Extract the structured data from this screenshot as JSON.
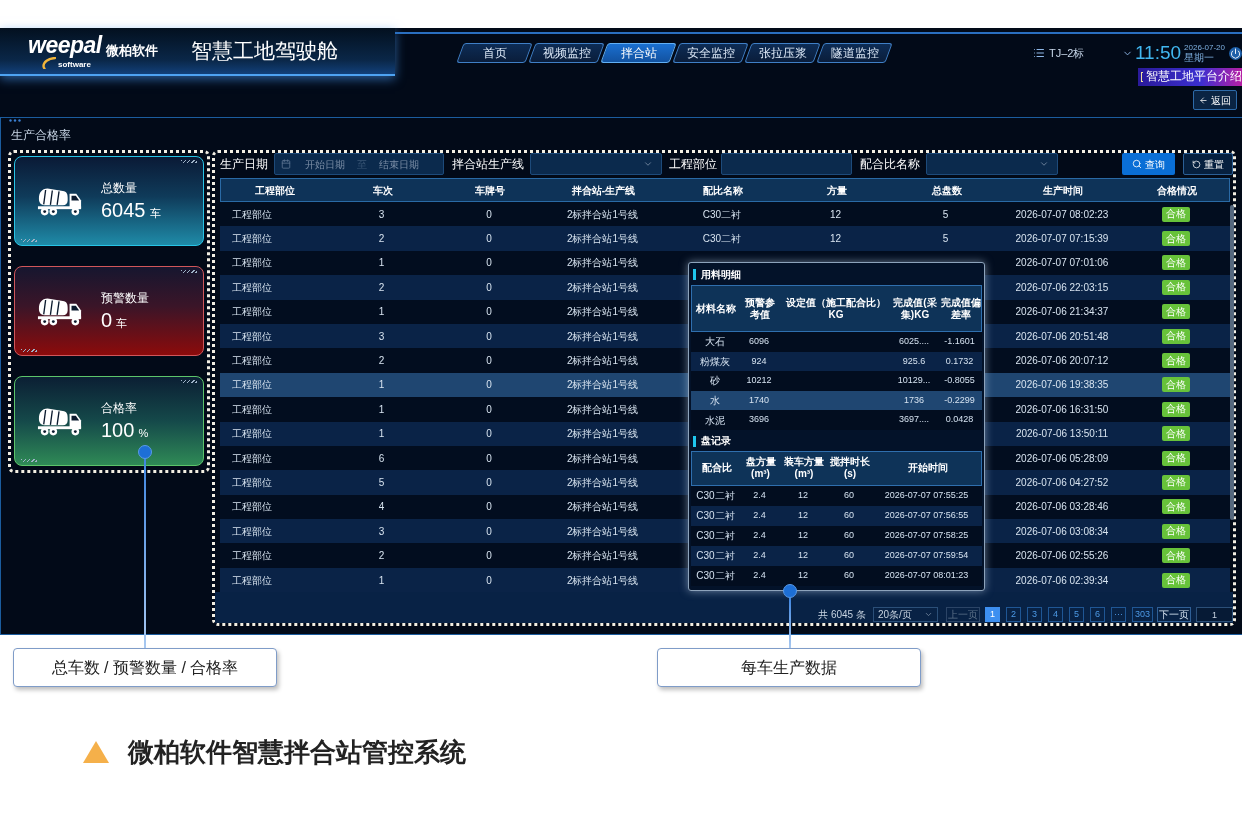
{
  "header": {
    "logo": {
      "wordmark": "weepal",
      "tagline": "software",
      "company": "微柏软件"
    },
    "title": "智慧工地驾驶舱",
    "nav_tabs": [
      {
        "label": "首页",
        "selected": false
      },
      {
        "label": "视频监控",
        "selected": false
      },
      {
        "label": "拌合站",
        "selected": true
      },
      {
        "label": "安全监控",
        "selected": false
      },
      {
        "label": "张拉压浆",
        "selected": false
      },
      {
        "label": "隧道监控",
        "selected": false
      }
    ],
    "project": "TJ–2标",
    "time": "11:50",
    "date": "2026-07-20",
    "weekday": "星期一",
    "intro_banner": "智慧工地平台介绍",
    "back_button": "返回"
  },
  "section_title": "生产合格率",
  "stat_cards": [
    {
      "kind": "total",
      "label": "总数量",
      "value": "6045",
      "unit": "车"
    },
    {
      "kind": "warning",
      "label": "预警数量",
      "value": "0",
      "unit": "车"
    },
    {
      "kind": "rate",
      "label": "合格率",
      "value": "100",
      "unit": "%"
    }
  ],
  "filters": {
    "date_label": "生产日期",
    "start_placeholder": "开始日期",
    "separator": "至",
    "end_placeholder": "结束日期",
    "line_label": "拌合站生产线",
    "part_label": "工程部位",
    "mix_label": "配合比名称",
    "query_button": "查询",
    "reset_button": "重置"
  },
  "table": {
    "columns": [
      "工程部位",
      "车次",
      "车牌号",
      "拌合站-生产线",
      "配比名称",
      "方量",
      "总盘数",
      "生产时间",
      "合格情况"
    ],
    "rows": [
      {
        "part": "工程部位",
        "trip": "3",
        "plate": "0",
        "line": "2标拌合站1号线",
        "mix": "C30二衬",
        "volume": "12",
        "batches": "5",
        "time": "2026-07-07 08:02:23",
        "status": "合格",
        "selected": false
      },
      {
        "part": "工程部位",
        "trip": "2",
        "plate": "0",
        "line": "2标拌合站1号线",
        "mix": "C30二衬",
        "volume": "12",
        "batches": "5",
        "time": "2026-07-07 07:15:39",
        "status": "合格",
        "selected": false
      },
      {
        "part": "工程部位",
        "trip": "1",
        "plate": "0",
        "line": "2标拌合站1号线",
        "time": "2026-07-07 07:01:06",
        "status": "合格",
        "selected": false
      },
      {
        "part": "工程部位",
        "trip": "2",
        "plate": "0",
        "line": "2标拌合站1号线",
        "time": "2026-07-06 22:03:15",
        "status": "合格",
        "selected": false
      },
      {
        "part": "工程部位",
        "trip": "1",
        "plate": "0",
        "line": "2标拌合站1号线",
        "time": "2026-07-06 21:34:37",
        "status": "合格",
        "selected": false
      },
      {
        "part": "工程部位",
        "trip": "3",
        "plate": "0",
        "line": "2标拌合站1号线",
        "time": "2026-07-06 20:51:48",
        "status": "合格",
        "selected": false
      },
      {
        "part": "工程部位",
        "trip": "2",
        "plate": "0",
        "line": "2标拌合站1号线",
        "time": "2026-07-06 20:07:12",
        "status": "合格",
        "selected": false
      },
      {
        "part": "工程部位",
        "trip": "1",
        "plate": "0",
        "line": "2标拌合站1号线",
        "time": "2026-07-06 19:38:35",
        "status": "合格",
        "selected": true
      },
      {
        "part": "工程部位",
        "trip": "1",
        "plate": "0",
        "line": "2标拌合站1号线",
        "time": "2026-07-06 16:31:50",
        "status": "合格",
        "selected": false
      },
      {
        "part": "工程部位",
        "trip": "1",
        "plate": "0",
        "line": "2标拌合站1号线",
        "time": "2026-07-06 13:50:11",
        "status": "合格",
        "selected": false
      },
      {
        "part": "工程部位",
        "trip": "6",
        "plate": "0",
        "line": "2标拌合站1号线",
        "time": "2026-07-06 05:28:09",
        "status": "合格",
        "selected": false
      },
      {
        "part": "工程部位",
        "trip": "5",
        "plate": "0",
        "line": "2标拌合站1号线",
        "time": "2026-07-06 04:27:52",
        "status": "合格",
        "selected": false
      },
      {
        "part": "工程部位",
        "trip": "4",
        "plate": "0",
        "line": "2标拌合站1号线",
        "time": "2026-07-06 03:28:46",
        "status": "合格",
        "selected": false
      },
      {
        "part": "工程部位",
        "trip": "3",
        "plate": "0",
        "line": "2标拌合站1号线",
        "time": "2026-07-06 03:08:34",
        "status": "合格",
        "selected": false
      },
      {
        "part": "工程部位",
        "trip": "2",
        "plate": "0",
        "line": "2标拌合站1号线",
        "time": "2026-07-06 02:55:26",
        "status": "合格",
        "selected": false
      },
      {
        "part": "工程部位",
        "trip": "1",
        "plate": "0",
        "line": "2标拌合站1号线",
        "time": "2026-07-06 02:39:34",
        "status": "合格",
        "selected": false
      }
    ]
  },
  "detail_popup": {
    "materials": {
      "title": "用料明细",
      "columns": [
        "材料名称",
        "预警参考值",
        "设定值（施工配合比）KG",
        "完成值(采集)KG",
        "完成值偏差率"
      ],
      "rows": [
        {
          "name": "大石",
          "warning_ref": "6096",
          "done": "6025....",
          "deviation": "-1.1601",
          "selected": false
        },
        {
          "name": "粉煤灰",
          "warning_ref": "924",
          "done": "925.6",
          "deviation": "0.1732",
          "selected": false
        },
        {
          "name": "砂",
          "warning_ref": "10212",
          "done": "10129...",
          "deviation": "-0.8055",
          "selected": false
        },
        {
          "name": "水",
          "warning_ref": "1740",
          "done": "1736",
          "deviation": "-0.2299",
          "selected": true
        },
        {
          "name": "水泥",
          "warning_ref": "3696",
          "done": "3697....",
          "deviation": "0.0428",
          "selected": false
        }
      ]
    },
    "batches": {
      "title": "盘记录",
      "columns": [
        "配合比",
        "盘方量(m³)",
        "装车方量(m³)",
        "搅拌时长(s)",
        "开始时间"
      ],
      "rows": [
        [
          "C30二衬",
          "2.4",
          "12",
          "60",
          "2026-07-07 07:55:25"
        ],
        [
          "C30二衬",
          "2.4",
          "12",
          "60",
          "2026-07-07 07:56:55"
        ],
        [
          "C30二衬",
          "2.4",
          "12",
          "60",
          "2026-07-07 07:58:25"
        ],
        [
          "C30二衬",
          "2.4",
          "12",
          "60",
          "2026-07-07 07:59:54"
        ],
        [
          "C30二衬",
          "2.4",
          "12",
          "60",
          "2026-07-07 08:01:23"
        ]
      ]
    }
  },
  "pagination": {
    "total": "共 6045 条",
    "page_size": "20条/页",
    "prev": {
      "label": "上一页",
      "disabled": true
    },
    "pages": [
      {
        "label": "1",
        "selected": true
      },
      {
        "label": "2",
        "selected": false
      },
      {
        "label": "3",
        "selected": false
      },
      {
        "label": "4",
        "selected": false
      },
      {
        "label": "5",
        "selected": false
      },
      {
        "label": "6",
        "selected": false
      },
      {
        "label": "···",
        "selected": false
      },
      {
        "label": "303",
        "selected": false
      }
    ],
    "next": {
      "label": "下一页",
      "disabled": false
    },
    "jump": "1"
  },
  "callouts": [
    "总车数 / 预警数量 / 合格率",
    "每车生产数据"
  ],
  "footer_title": "微柏软件智慧拌合站管控系统"
}
